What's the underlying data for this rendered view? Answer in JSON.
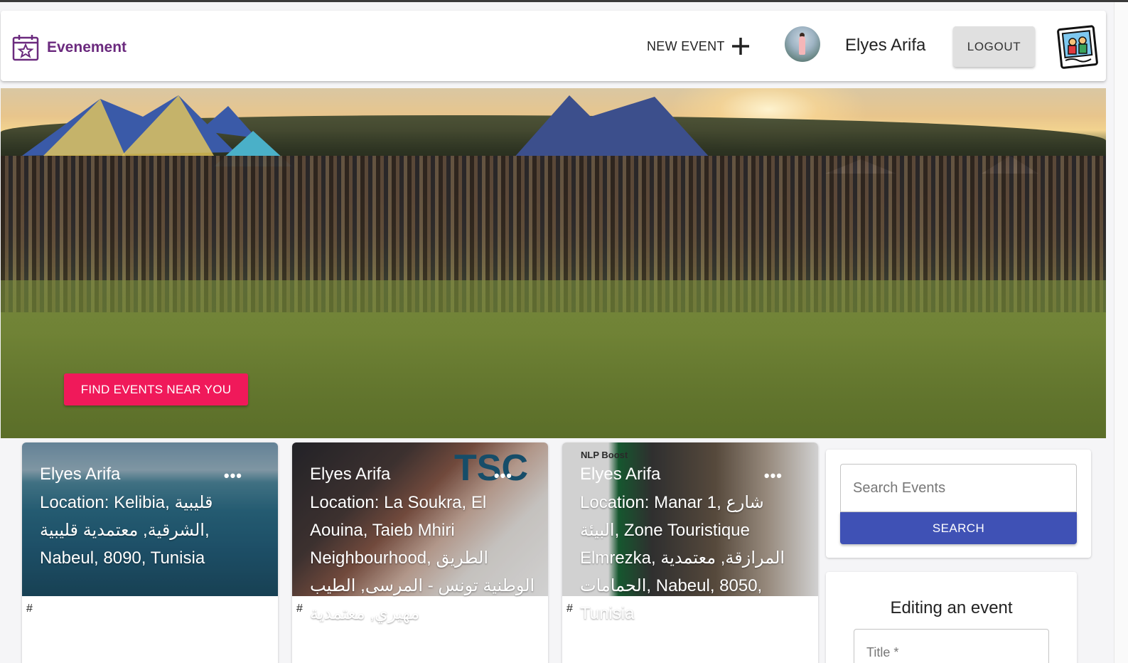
{
  "header": {
    "brand_name": "Evenement",
    "new_event_label": "NEW EVENT",
    "username": "Elyes Arifa",
    "logout_label": "LOGOUT"
  },
  "hero": {
    "cta_label": "FIND EVENTS NEAR YOU"
  },
  "cards": [
    {
      "author": "Elyes Arifa",
      "location": "Location: Kelibia, قليبية الشرقية, معتمدية قليبية, Nabeul, 8090, Tunisia",
      "menu": "•••",
      "link": "#"
    },
    {
      "author": "Elyes Arifa",
      "location": "Location: La Soukra, El Aouina, Taieb Mhiri Neighbourhood, الطريق الوطنية تونس - المرسى, الطيب مهيري, معتمدية",
      "menu": "•••",
      "link": "#",
      "logo_text": "TSC"
    },
    {
      "author": "Elyes Arifa",
      "location": "Location: Manar 1, شارع البيئة, Zone Touristique Elmrezka, المرازقة, معتمدية الحمامات, Nabeul, 8050, Tunisia",
      "menu": "•••",
      "link": "#",
      "logo_text": "NLP Boost"
    }
  ],
  "search": {
    "placeholder": "Search Events",
    "button_label": "SEARCH"
  },
  "edit_form": {
    "heading": "Editing an event",
    "title_label": "Title *"
  },
  "colors": {
    "brand": "#6b2a7e",
    "cta": "#f0195a",
    "primary": "#3f51b5"
  }
}
